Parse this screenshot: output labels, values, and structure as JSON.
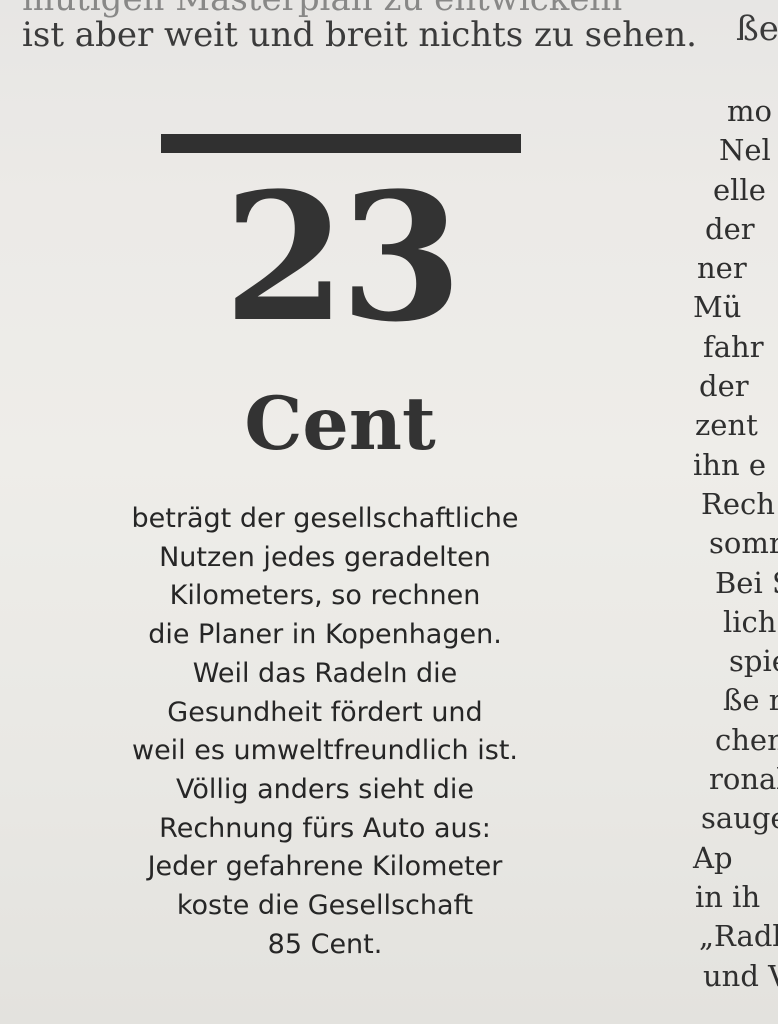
{
  "header": {
    "top_left_fragment": "mutigen Masterplan zu entwickeln",
    "top_left_text": "ist aber weit und breit nichts zu sehen.",
    "top_right_fragment": "ße"
  },
  "feature": {
    "number": "23",
    "unit": "Cent",
    "lines": [
      "beträgt der gesellschaftliche",
      "Nutzen jedes geradelten",
      "Kilometers, so rechnen",
      "die Planer in Kopenhagen.",
      "Weil das Radeln die",
      "Gesundheit fördert und",
      "weil es umweltfreundlich ist.",
      "Völlig anders sieht die",
      "Rechnung fürs Auto aus:",
      "Jeder gefahrene Kilometer",
      "koste die Gesellschaft",
      "85 Cent."
    ]
  },
  "right_column": {
    "lines": [
      "mo",
      "Nel",
      "elle",
      "der",
      "ner",
      "Mü",
      "fahr",
      "der",
      "zent",
      "ihn e",
      "Rech",
      "somr",
      "Bei S",
      "lich e",
      "spieg",
      "ße ru",
      "chen l",
      "ronal",
      "sauge",
      "Ap",
      "in ih",
      "„Radl",
      "und V"
    ]
  }
}
